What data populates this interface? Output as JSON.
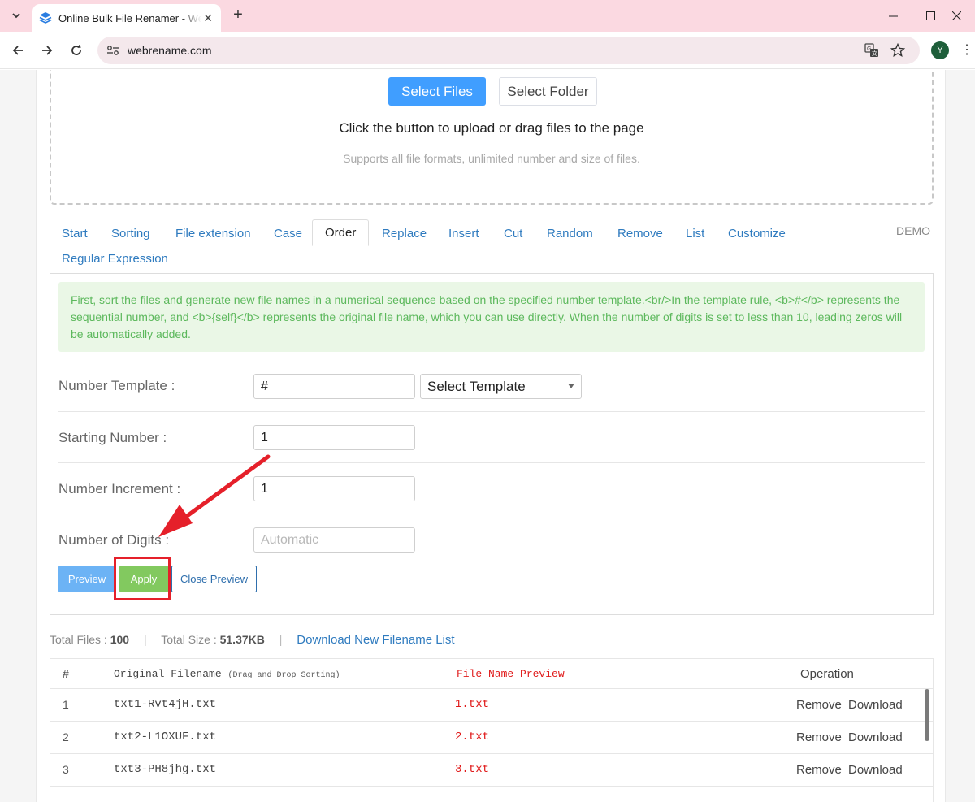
{
  "browser": {
    "tab_title": "Online Bulk File Renamer - Webrename",
    "url": "webrename.com",
    "profile_initial": "Y"
  },
  "upload": {
    "select_files": "Select Files",
    "select_folder": "Select Folder",
    "main_text": "Click the button to upload or drag files to the page",
    "sub_text": "Supports all file formats, unlimited number and size of files."
  },
  "tabs": [
    {
      "label": "Start"
    },
    {
      "label": "Sorting"
    },
    {
      "label": "File extension"
    },
    {
      "label": "Case"
    },
    {
      "label": "Order",
      "active": true
    },
    {
      "label": "Replace"
    },
    {
      "label": "Insert"
    },
    {
      "label": "Cut"
    },
    {
      "label": "Random"
    },
    {
      "label": "Remove"
    },
    {
      "label": "List"
    },
    {
      "label": "Customize"
    },
    {
      "label": "Regular Expression"
    }
  ],
  "demo_label": "DEMO",
  "info_text": "First, sort the files and generate new file names in a numerical sequence based on the specified number template.<br/>In the template rule, <b>#</b> represents the sequential number, and <b>{self}</b> represents the original file name, which you can use directly. When the number of digits is set to less than 10, leading zeros will be automatically added.",
  "form": {
    "number_template": {
      "label": "Number Template :",
      "value": "#",
      "select_label": "Select Template"
    },
    "starting_number": {
      "label": "Starting Number :",
      "value": "1"
    },
    "number_increment": {
      "label": "Number Increment :",
      "value": "1"
    },
    "number_of_digits": {
      "label": "Number of Digits :",
      "value": "",
      "placeholder": "Automatic"
    }
  },
  "buttons": {
    "preview": "Preview",
    "apply": "Apply",
    "close_preview": "Close Preview"
  },
  "stats": {
    "total_files_label": "Total Files :",
    "total_files": "100",
    "separator": "|",
    "total_size_label": "Total Size :",
    "total_size": "51.37KB",
    "download_list": "Download New Filename List"
  },
  "table": {
    "headers": {
      "index": "#",
      "original": "Original Filename",
      "original_hint": "(Drag and Drop Sorting)",
      "preview": "File Name Preview",
      "operation": "Operation"
    },
    "rows": [
      {
        "index": "1",
        "original": "txt1-Rvt4jH.txt",
        "preview": "1.txt"
      },
      {
        "index": "2",
        "original": "txt2-L1OXUF.txt",
        "preview": "2.txt"
      },
      {
        "index": "3",
        "original": "txt3-PH8jhg.txt",
        "preview": "3.txt"
      }
    ],
    "remove_label": "Remove",
    "download_label": "Download"
  },
  "colors": {
    "primary": "#409eff",
    "apply": "#82c95f",
    "annotation_red": "#e5202a",
    "preview_red": "#e01b1b",
    "info_bg": "#eaf7e6",
    "info_text": "#5cb85c"
  }
}
